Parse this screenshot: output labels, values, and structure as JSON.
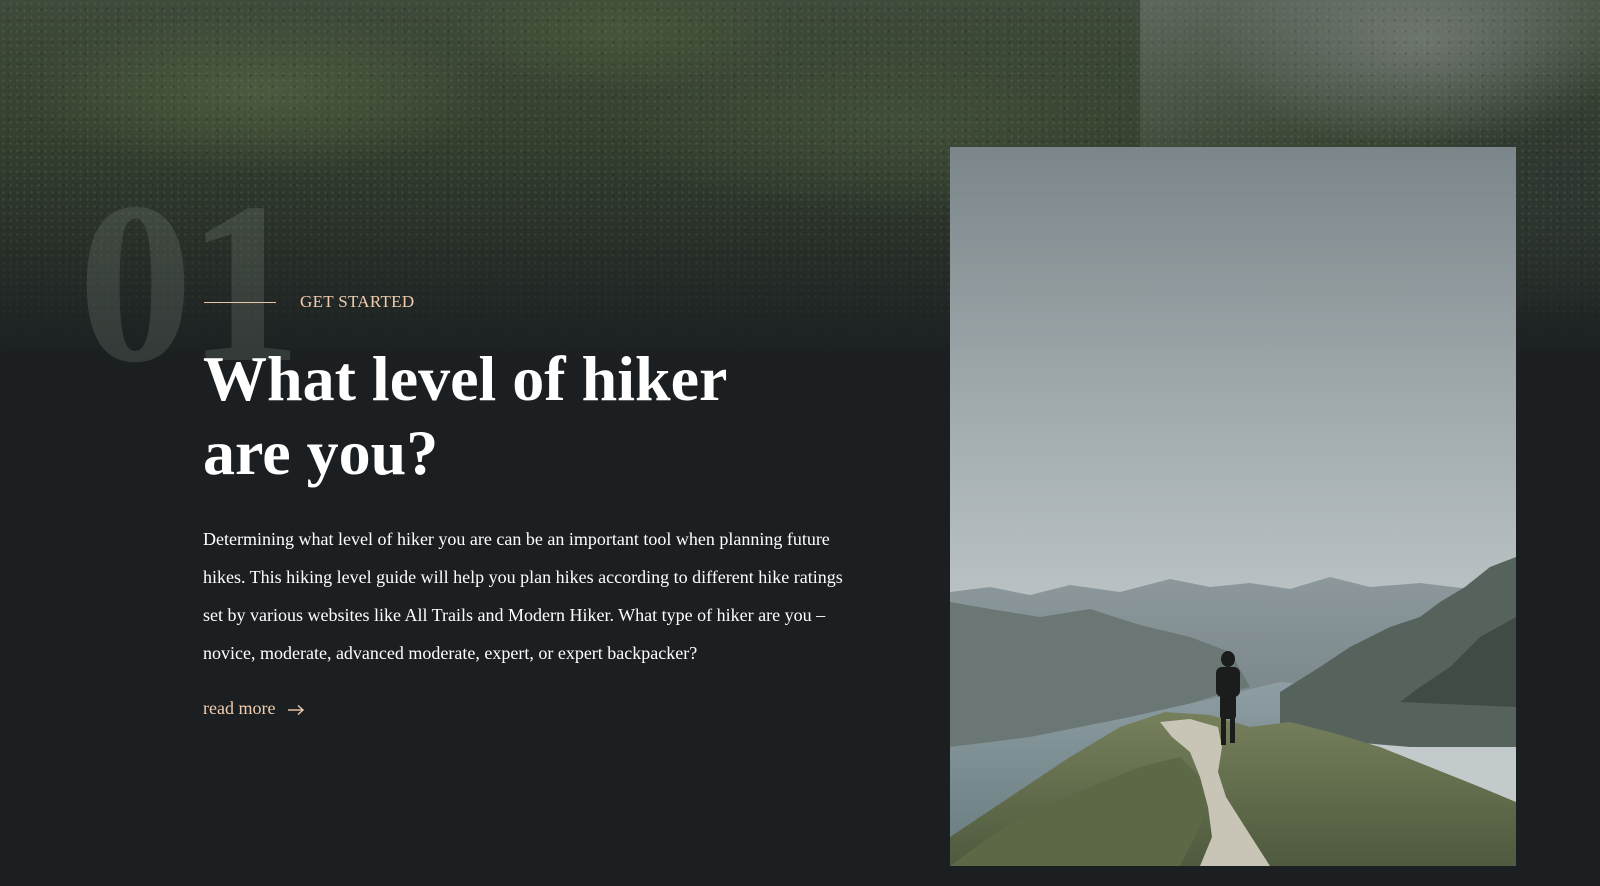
{
  "hero": {
    "number": "01",
    "eyebrow": "GET STARTED",
    "title": "What level of hiker are you?",
    "body": "Determining what level of hiker you are can be an important tool when planning future hikes. This hiking level guide will help you plan hikes according to different hike ratings set by various websites like All Trails and Modern Hiker. What type of hiker are you – novice, moderate, advanced moderate, expert, or expert backpacker?",
    "link_label": "read more"
  },
  "icons": {
    "link_arrow": "arrow-right-icon"
  },
  "colors": {
    "background": "#1b1f21",
    "accent": "#f0cdb0",
    "heading": "#ffffff"
  }
}
